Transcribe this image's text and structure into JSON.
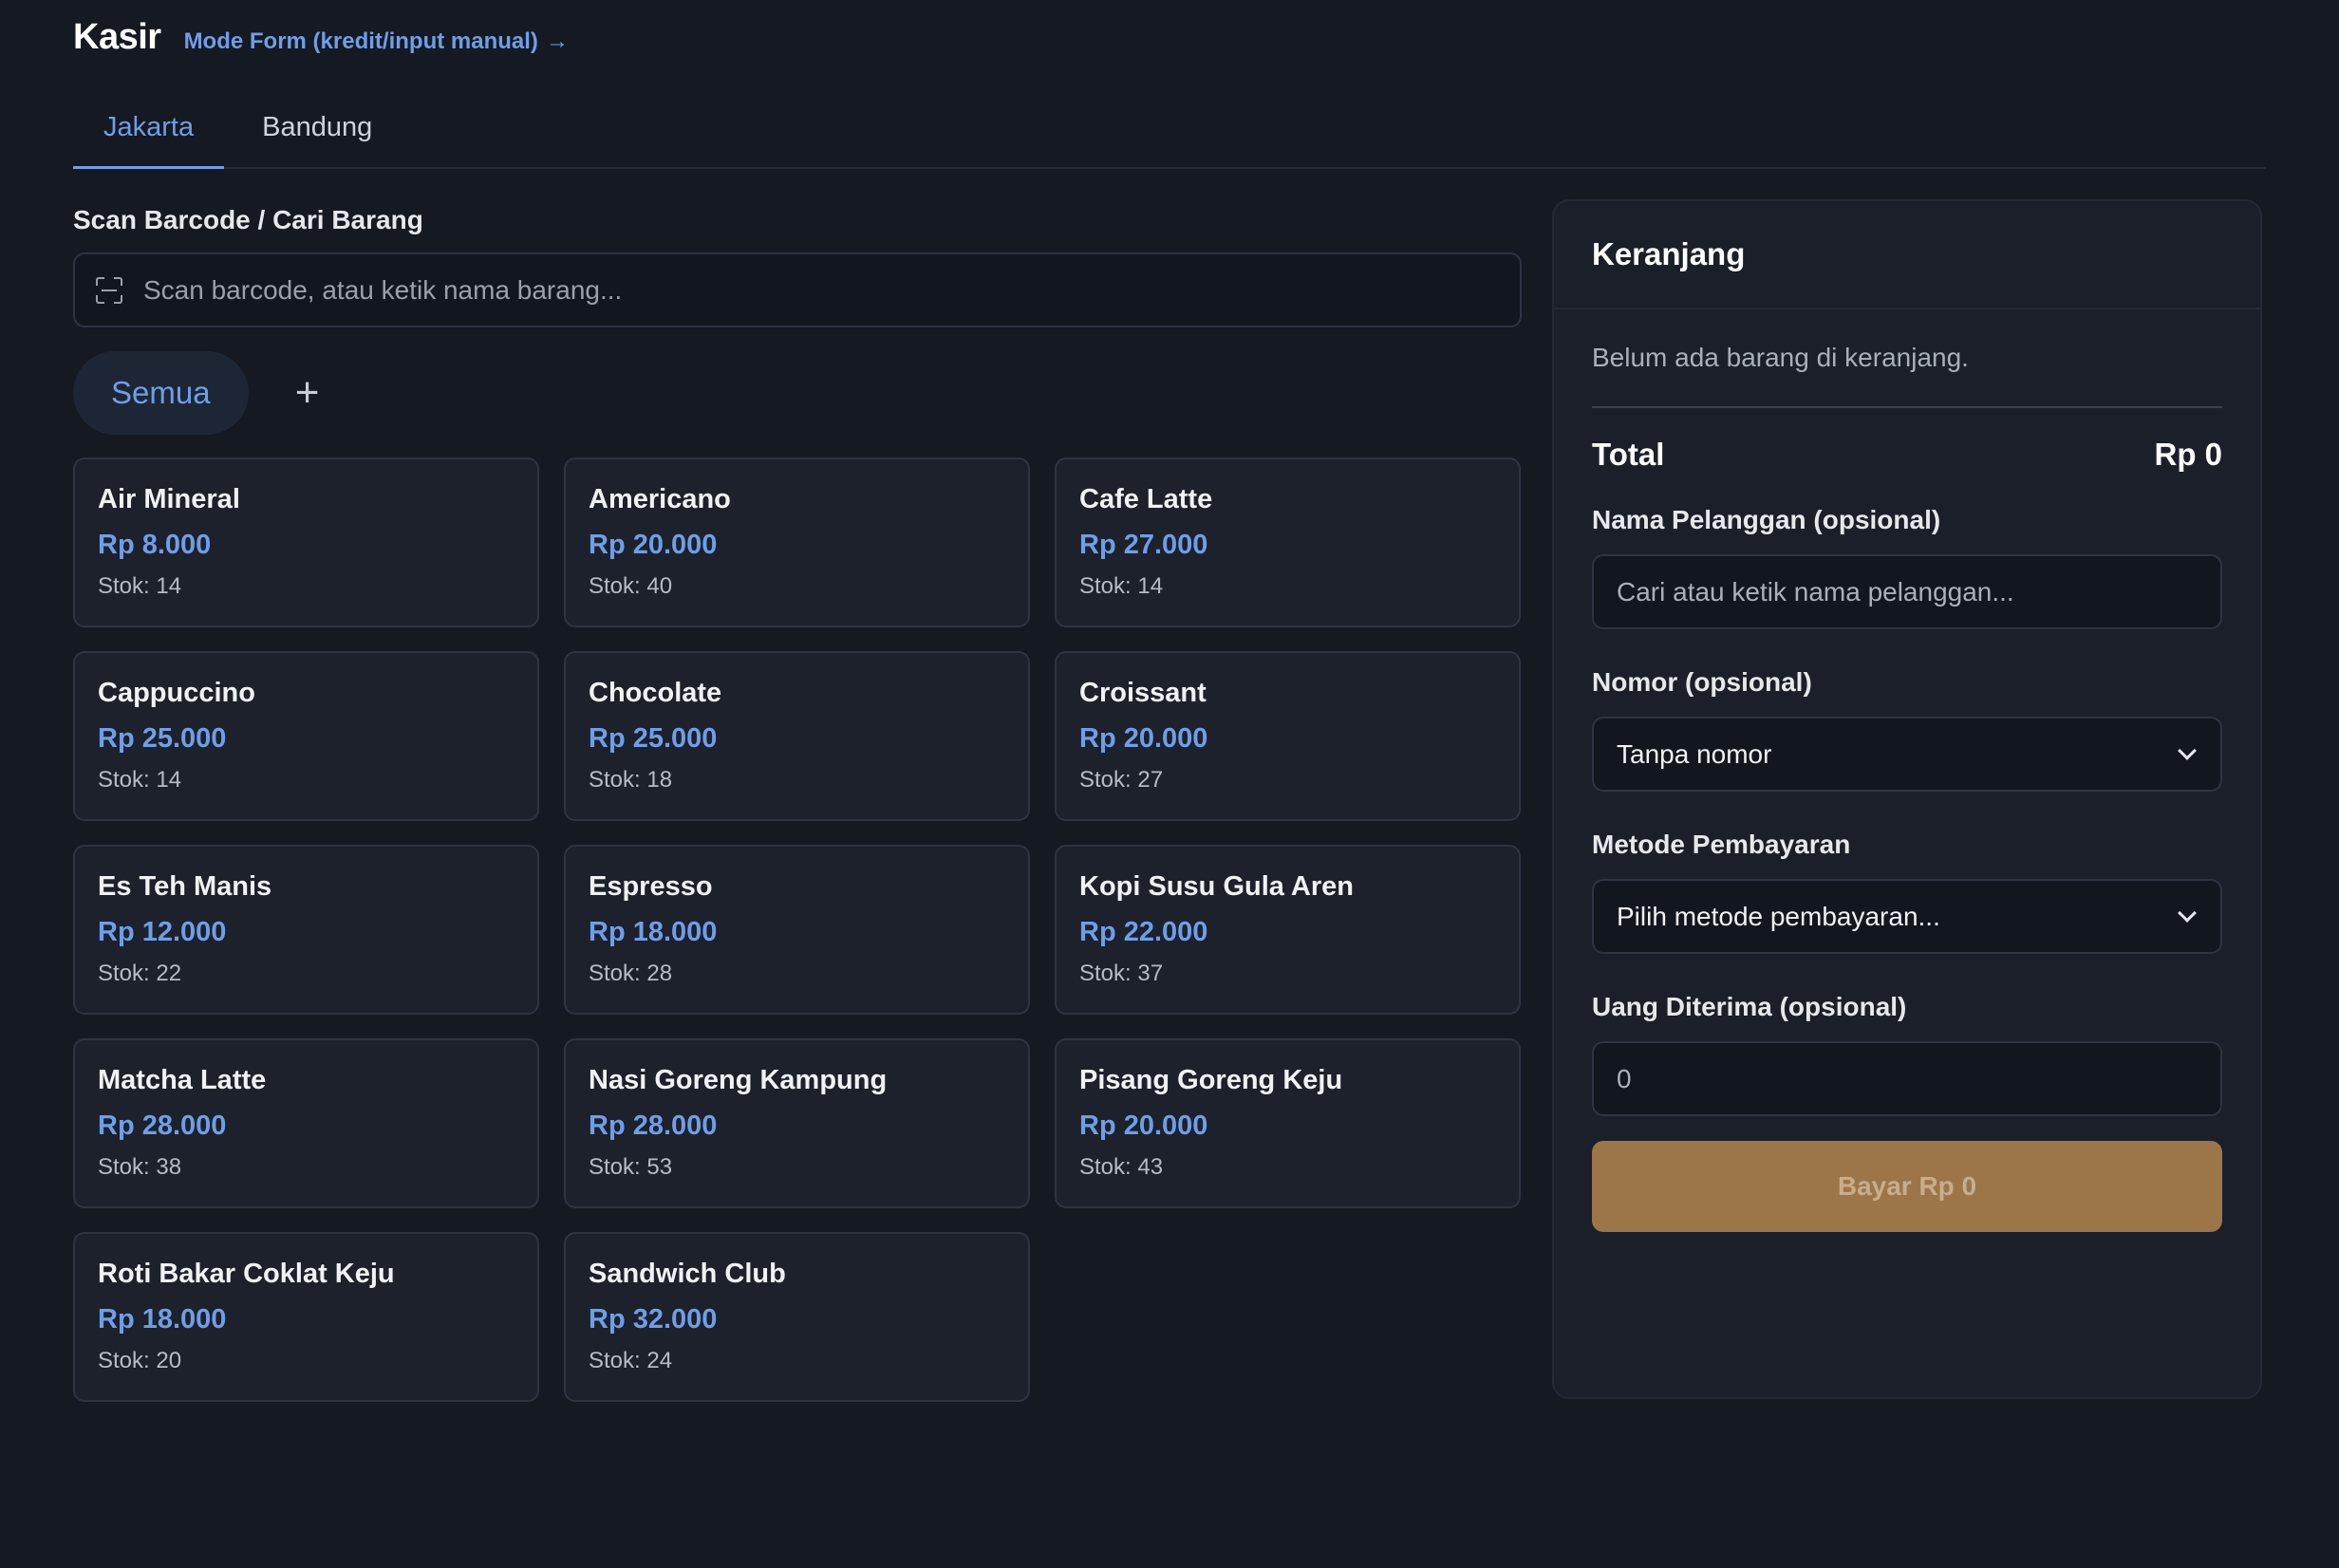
{
  "header": {
    "title": "Kasir",
    "mode_link": "Mode Form (kredit/input manual)",
    "mode_arrow": "→"
  },
  "tabs": [
    {
      "label": "Jakarta",
      "active": true
    },
    {
      "label": "Bandung",
      "active": false
    }
  ],
  "search": {
    "label": "Scan Barcode / Cari Barang",
    "placeholder": "Scan barcode, atau ketik nama barang..."
  },
  "categories": {
    "selected": "Semua",
    "add_symbol": "+"
  },
  "products": [
    {
      "name": "Air Mineral",
      "price": "Rp 8.000",
      "stock": "Stok: 14"
    },
    {
      "name": "Americano",
      "price": "Rp 20.000",
      "stock": "Stok: 40"
    },
    {
      "name": "Cafe Latte",
      "price": "Rp 27.000",
      "stock": "Stok: 14"
    },
    {
      "name": "Cappuccino",
      "price": "Rp 25.000",
      "stock": "Stok: 14"
    },
    {
      "name": "Chocolate",
      "price": "Rp 25.000",
      "stock": "Stok: 18"
    },
    {
      "name": "Croissant",
      "price": "Rp 20.000",
      "stock": "Stok: 27"
    },
    {
      "name": "Es Teh Manis",
      "price": "Rp 12.000",
      "stock": "Stok: 22"
    },
    {
      "name": "Espresso",
      "price": "Rp 18.000",
      "stock": "Stok: 28"
    },
    {
      "name": "Kopi Susu Gula Aren",
      "price": "Rp 22.000",
      "stock": "Stok: 37"
    },
    {
      "name": "Matcha Latte",
      "price": "Rp 28.000",
      "stock": "Stok: 38"
    },
    {
      "name": "Nasi Goreng Kampung",
      "price": "Rp 28.000",
      "stock": "Stok: 53"
    },
    {
      "name": "Pisang Goreng Keju",
      "price": "Rp 20.000",
      "stock": "Stok: 43"
    },
    {
      "name": "Roti Bakar Coklat Keju",
      "price": "Rp 18.000",
      "stock": "Stok: 20"
    },
    {
      "name": "Sandwich Club",
      "price": "Rp 32.000",
      "stock": "Stok: 24"
    }
  ],
  "cart": {
    "title": "Keranjang",
    "empty_text": "Belum ada barang di keranjang.",
    "total_label": "Total",
    "total_value": "Rp 0",
    "customer_label": "Nama Pelanggan (opsional)",
    "customer_placeholder": "Cari atau ketik nama pelanggan...",
    "number_label": "Nomor (opsional)",
    "number_value": "Tanpa nomor",
    "payment_label": "Metode Pembayaran",
    "payment_value": "Pilih metode pembayaran...",
    "cash_label": "Uang Diterima (opsional)",
    "cash_placeholder": "0",
    "pay_button": "Bayar Rp 0"
  },
  "colors": {
    "accent": "#6f9ee8",
    "background": "#151922",
    "pay_button": "#9c7648"
  }
}
